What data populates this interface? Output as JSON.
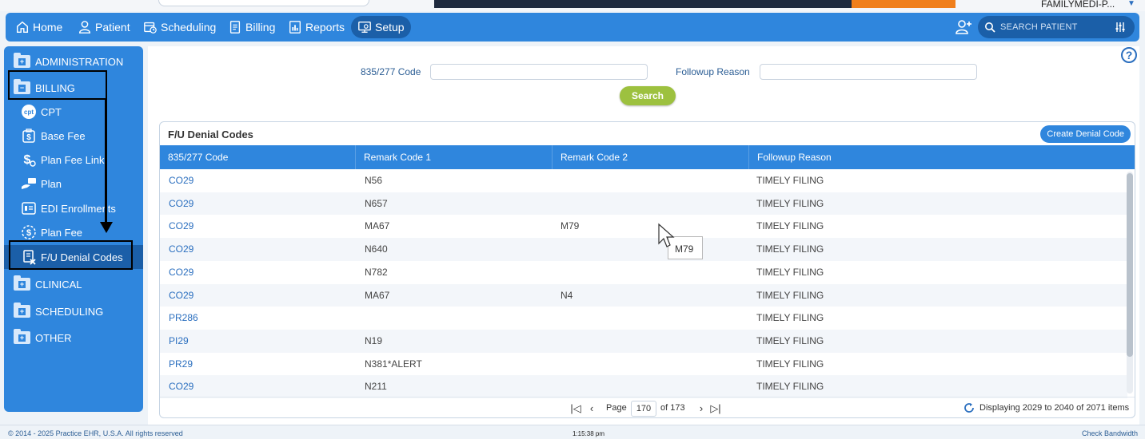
{
  "topbar": {
    "facility": "FAMILYMEDI-P..."
  },
  "nav": {
    "items": [
      {
        "label": "Home",
        "icon": "home-icon"
      },
      {
        "label": "Patient",
        "icon": "person-icon"
      },
      {
        "label": "Scheduling",
        "icon": "calendar-clock-icon"
      },
      {
        "label": "Billing",
        "icon": "document-icon"
      },
      {
        "label": "Reports",
        "icon": "report-chart-icon"
      },
      {
        "label": "Setup",
        "icon": "monitor-gear-icon"
      }
    ],
    "active": "Setup",
    "search_placeholder": "SEARCH PATIENT"
  },
  "sidebar": {
    "folders": {
      "administration": "ADMINISTRATION",
      "billing": "BILLING",
      "clinical": "CLINICAL",
      "scheduling": "SCHEDULING",
      "other": "OTHER"
    },
    "billing_items": [
      {
        "label": "CPT",
        "icon": "cpt-icon"
      },
      {
        "label": "Base Fee",
        "icon": "dollar-document-icon"
      },
      {
        "label": "Plan Fee Link",
        "icon": "dollar-link-icon"
      },
      {
        "label": "Plan",
        "icon": "hand-card-icon"
      },
      {
        "label": "EDI Enrollments",
        "icon": "id-card-icon"
      },
      {
        "label": "Plan Fee",
        "icon": "dollar-circle-icon"
      },
      {
        "label": "F/U Denial Codes",
        "icon": "denial-document-icon"
      }
    ]
  },
  "filters": {
    "code_label": "835/277 Code",
    "code_value": "",
    "reason_label": "Followup Reason",
    "reason_value": "",
    "search_button": "Search"
  },
  "grid": {
    "title": "F/U Denial Codes",
    "create_button": "Create Denial Code",
    "columns": [
      "835/277 Code",
      "Remark Code 1",
      "Remark Code 2",
      "Followup Reason"
    ],
    "rows": [
      [
        "CO29",
        "N56",
        "",
        "TIMELY FILING"
      ],
      [
        "CO29",
        "N657",
        "",
        "TIMELY FILING"
      ],
      [
        "CO29",
        "MA67",
        "M79",
        "TIMELY FILING"
      ],
      [
        "CO29",
        "N640",
        "",
        "TIMELY FILING"
      ],
      [
        "CO29",
        "N782",
        "",
        "TIMELY FILING"
      ],
      [
        "CO29",
        "MA67",
        "N4",
        "TIMELY FILING"
      ],
      [
        "PR286",
        "",
        "",
        "TIMELY FILING"
      ],
      [
        "PI29",
        "N19",
        "",
        "TIMELY FILING"
      ],
      [
        "PR29",
        "N381*ALERT",
        "",
        "TIMELY FILING"
      ],
      [
        "CO29",
        "N211",
        "",
        "TIMELY FILING"
      ]
    ],
    "tooltip": "M79",
    "pager": {
      "page_label": "Page",
      "page_value": "170",
      "of_label": "of 173",
      "display_text": "Displaying 2029 to 2040 of 2071 items"
    }
  },
  "footer": {
    "copyright": "© 2014 - 2025 Practice EHR, U.S.A. All rights reserved",
    "time": "1:15:38 pm",
    "bandwidth": "Check Bandwidth"
  },
  "colors": {
    "primary": "#2f86dd",
    "active": "#1b5fa8",
    "search_button": "#9dc13f",
    "link": "#2b6fbf"
  }
}
